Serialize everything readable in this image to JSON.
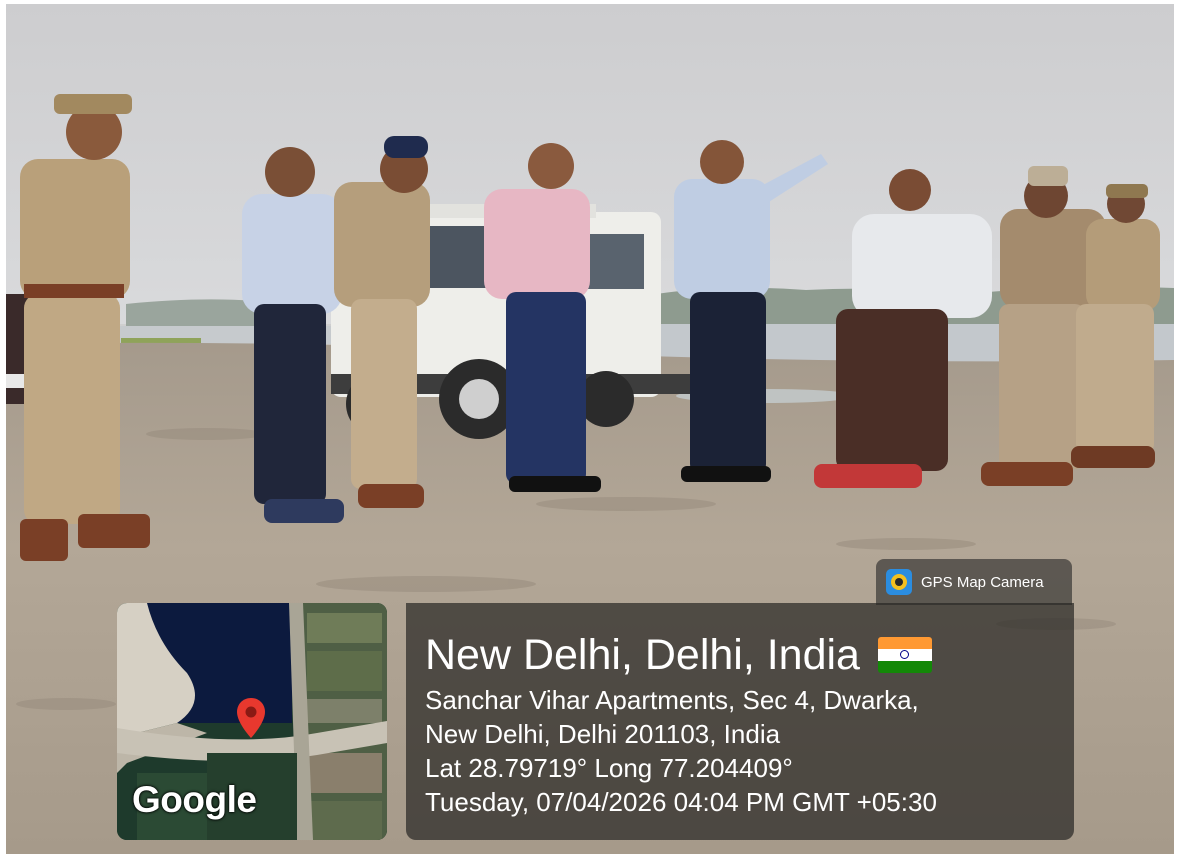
{
  "gps_tag": {
    "app_name": "GPS Map Camera",
    "icon": "gps-map-camera-icon"
  },
  "map": {
    "logo_text": "Google",
    "pin_icon": "map-pin-icon",
    "pin_color": "#e8382e"
  },
  "location": {
    "title": "New Delhi, Delhi, India",
    "flag_icon": "india-flag-icon",
    "address_line_1": "Sanchar Vihar Apartments, Sec 4, Dwarka,",
    "address_line_2": "New Delhi, Delhi 201103, India",
    "coordinates": "Lat 28.79719° Long 77.204409°",
    "timestamp": "Tuesday, 07/04/2026 04:04 PM GMT +05:30"
  }
}
